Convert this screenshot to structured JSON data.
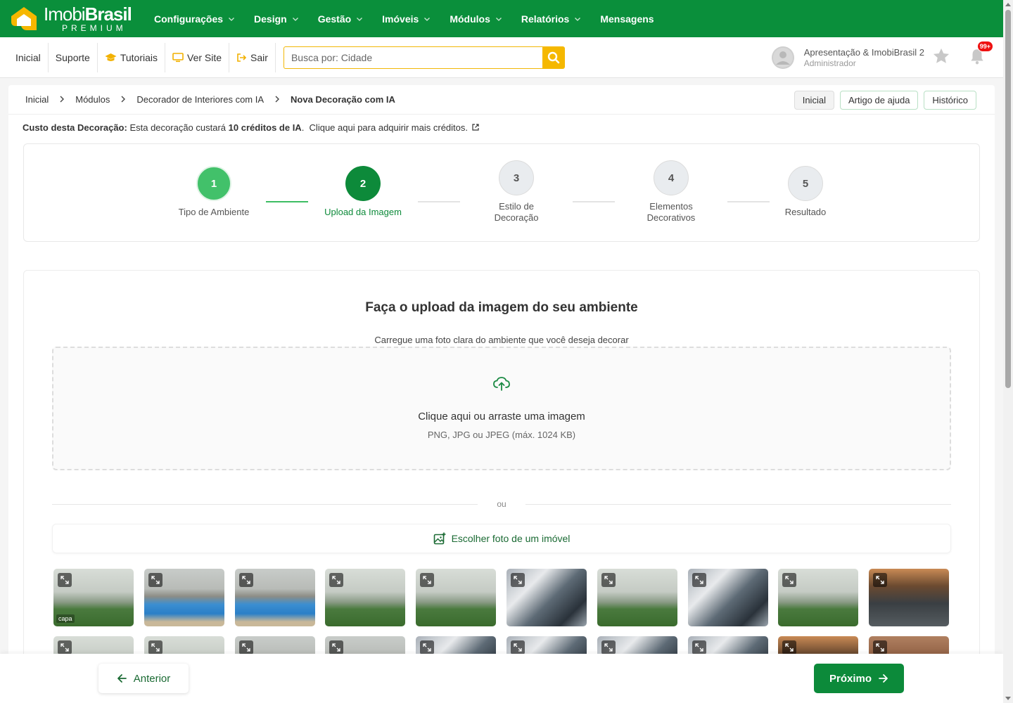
{
  "brand": {
    "name_light": "Imobi",
    "name_bold": "Brasil",
    "tagline": "PREMIUM"
  },
  "nav": [
    {
      "label": "Configurações",
      "has_dropdown": true
    },
    {
      "label": "Design",
      "has_dropdown": true
    },
    {
      "label": "Gestão",
      "has_dropdown": true
    },
    {
      "label": "Imóveis",
      "has_dropdown": true
    },
    {
      "label": "Módulos",
      "has_dropdown": true
    },
    {
      "label": "Relatórios",
      "has_dropdown": true
    },
    {
      "label": "Mensagens",
      "has_dropdown": false
    }
  ],
  "subnav": {
    "inicial": "Inicial",
    "suporte": "Suporte",
    "tutoriais": "Tutoriais",
    "ver_site": "Ver Site",
    "sair": "Sair"
  },
  "search": {
    "placeholder": "Busca por: Cidade",
    "value": ""
  },
  "user": {
    "name": "Apresentação & ImobiBrasil 2",
    "role": "Administrador",
    "notifications_badge": "99+"
  },
  "breadcrumb": {
    "items": [
      "Inicial",
      "Módulos",
      "Decorador de Interiores com IA"
    ],
    "current": "Nova Decoração com IA"
  },
  "header_buttons": {
    "inicial": "Inicial",
    "help": "Artigo de ajuda",
    "history": "Histórico"
  },
  "cost": {
    "label": "Custo desta Decoração:",
    "text_before": "Esta decoração custará",
    "credits": "10 créditos de IA",
    "link": "Clique aqui para adquirir mais créditos."
  },
  "steps": [
    {
      "number": "1",
      "label": "Tipo de Ambiente",
      "status": "done"
    },
    {
      "number": "2",
      "label": "Upload da Imagem",
      "status": "active"
    },
    {
      "number": "3",
      "label": "Estilo de Decoração",
      "status": "todo"
    },
    {
      "number": "4",
      "label": "Elementos Decorativos",
      "status": "todo"
    },
    {
      "number": "5",
      "label": "Resultado",
      "status": "todo"
    }
  ],
  "upload": {
    "title": "Faça o upload da imagem do seu ambiente",
    "subtitle": "Carregue uma foto clara do ambiente que você deseja decorar",
    "drop_main": "Clique aqui ou arraste uma imagem",
    "drop_hint": "PNG, JPG ou JPEG (máx. 1024 KB)",
    "or": "ou",
    "pick_label": "Escolher foto de um imóvel",
    "cover_tag": "capa"
  },
  "thumbnails_row1": [
    "garden",
    "pool",
    "pool",
    "garden",
    "garden",
    "tower",
    "garden",
    "tower",
    "garden",
    "roof"
  ],
  "thumbnails_row2": [
    "garden",
    "garden",
    "pool",
    "pool",
    "tower",
    "tower",
    "tower",
    "tower",
    "roof",
    "wood"
  ],
  "actions": {
    "prev": "Anterior",
    "next": "Próximo"
  },
  "colors": {
    "brand_green": "#0a8f3b",
    "step_done": "#42c16a",
    "step_active": "#0d8a3a",
    "search_accent": "#f5b800",
    "badge_red": "#ee1111"
  }
}
